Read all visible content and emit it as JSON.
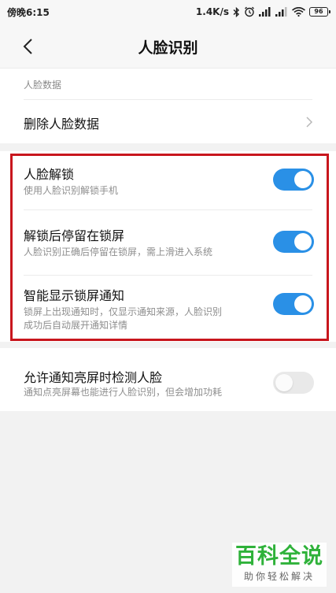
{
  "status_bar": {
    "time": "傍晚6:15",
    "speed": "1.4K/s",
    "battery": "96"
  },
  "header": {
    "title": "人脸识别"
  },
  "face_data_section": {
    "header": "人脸数据",
    "delete_label": "删除人脸数据"
  },
  "settings": [
    {
      "title": "人脸解锁",
      "subtitle": "使用人脸识别解锁手机",
      "enabled": true
    },
    {
      "title": "解锁后停留在锁屏",
      "subtitle": "人脸识别正确后停留在锁屏，需上滑进入系统",
      "enabled": true
    },
    {
      "title": "智能显示锁屏通知",
      "subtitle_line1": "锁屏上出现通知时，仅显示通知来源，人脸识别",
      "subtitle_line2": "成功后自动展开通知详情",
      "enabled": true
    },
    {
      "title": "允许通知亮屏时检测人脸",
      "subtitle": "通知点亮屏幕也能进行人脸识别，但会增加功耗",
      "enabled": false
    }
  ],
  "watermark": {
    "main": "百科全说",
    "sub": "助你轻松解决"
  },
  "colors": {
    "toggle_on": "#2a90e6",
    "toggle_off": "#e9e9e9",
    "highlight_border": "#c8161d",
    "watermark_green": "#2fb23a"
  }
}
